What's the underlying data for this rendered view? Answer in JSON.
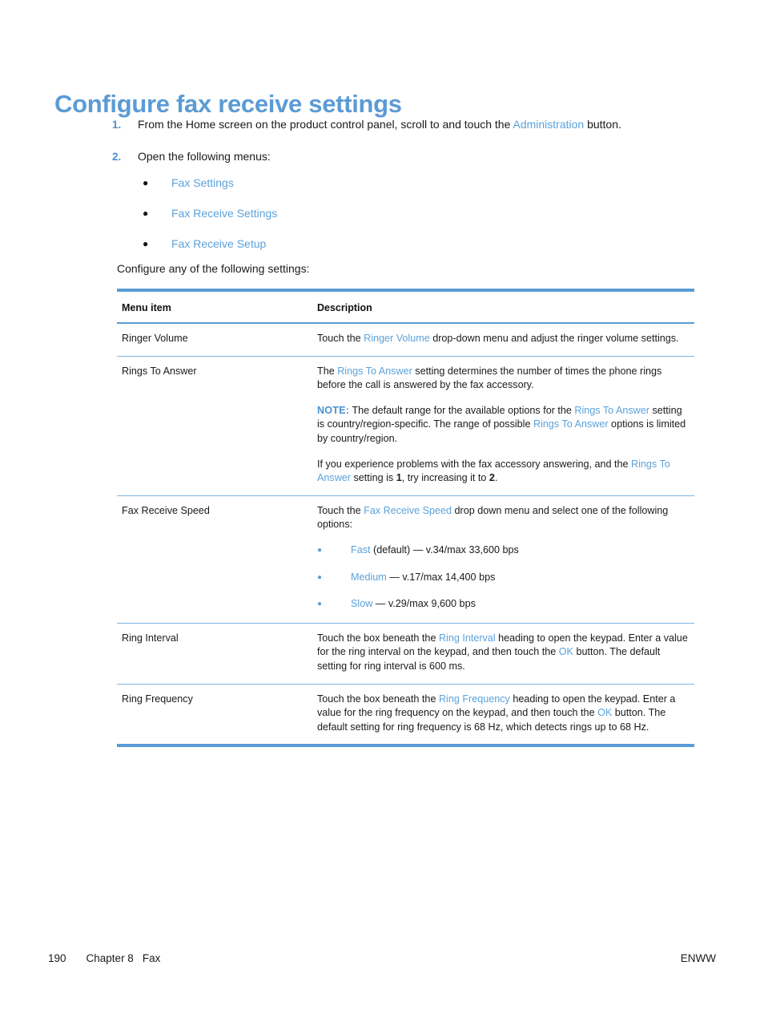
{
  "heading": "Configure fax receive settings",
  "steps": [
    {
      "num": "1.",
      "text_before": "From the Home screen on the product control panel, scroll to and touch the ",
      "link": "Administration",
      "text_after": " button."
    },
    {
      "num": "2.",
      "text_before": "Open the following menus:",
      "link": "",
      "text_after": ""
    }
  ],
  "menu_path_bullets": [
    {
      "bullet": "●",
      "label": "Fax Settings"
    },
    {
      "bullet": "●",
      "label": "Fax Receive Settings"
    },
    {
      "bullet": "●",
      "label": "Fax Receive Setup"
    }
  ],
  "lead_in": "Configure any of the following settings:",
  "table": {
    "headers": {
      "menu_item": "Menu item",
      "description": "Description"
    },
    "rows": [
      {
        "menu_item": "Ringer Volume",
        "paragraphs": [
          {
            "p1": "Touch the ",
            "link1": "Ringer Volume",
            "p2": " drop-down menu and adjust the ringer volume settings."
          }
        ]
      },
      {
        "menu_item": "Rings To Answer",
        "paragraphs": [
          {
            "p1": "The ",
            "link1": "Rings To Answer",
            "p2": " setting determines the number of times the phone rings before the call is answered by the fax accessory."
          },
          {
            "note_label": "NOTE:",
            "p1": "   The default range for the available options for the ",
            "link1": "Rings To Answer",
            "p2": " setting is country/region-specific. The range of possible ",
            "link2": "Rings To Answer",
            "p3": " options is limited by country/region."
          },
          {
            "p1": "If you experience problems with the fax accessory answering, and the ",
            "link1": "Rings To Answer",
            "p2": " setting is ",
            "bold1": "1",
            "p3": ", try increasing it to ",
            "bold2": "2",
            "p4": "."
          }
        ]
      },
      {
        "menu_item": "Fax Receive Speed",
        "paragraphs": [
          {
            "p1": "Touch the ",
            "link1": "Fax Receive Speed",
            "p2": " drop down menu and select one of the following options:"
          }
        ],
        "options": [
          {
            "bullet": "●",
            "link": "Fast",
            "rest": " (default) — v.34/max 33,600 bps"
          },
          {
            "bullet": "●",
            "link": "Medium",
            "rest": " — v.17/max 14,400 bps"
          },
          {
            "bullet": "●",
            "link": "Slow",
            "rest": " — v.29/max 9,600 bps"
          }
        ]
      },
      {
        "menu_item": "Ring Interval",
        "paragraphs": [
          {
            "p1": "Touch the box beneath the ",
            "link1": "Ring Interval",
            "p2": " heading to open the keypad. Enter a value for the ring interval on the keypad, and then touch the ",
            "link2": "OK",
            "p3": " button. The default setting for ring interval is 600 ms."
          }
        ]
      },
      {
        "menu_item": "Ring Frequency",
        "paragraphs": [
          {
            "p1": "Touch the box beneath the ",
            "link1": "Ring Frequency",
            "p2": " heading to open the keypad. Enter a value for the ring frequency on the keypad, and then touch the ",
            "link2": "OK",
            "p3": " button. The default setting for ring frequency is 68 Hz, which detects rings up to 68 Hz."
          }
        ]
      }
    ]
  },
  "footer": {
    "page_number": "190",
    "chapter": "Chapter 8",
    "section": "Fax",
    "right": "ENWW"
  },
  "colors": {
    "accent_blue": "#5b9bd5",
    "link_blue": "#5ba2dc",
    "rule_blue": "#7fb4e0",
    "body_black": "#1a1a1a"
  }
}
